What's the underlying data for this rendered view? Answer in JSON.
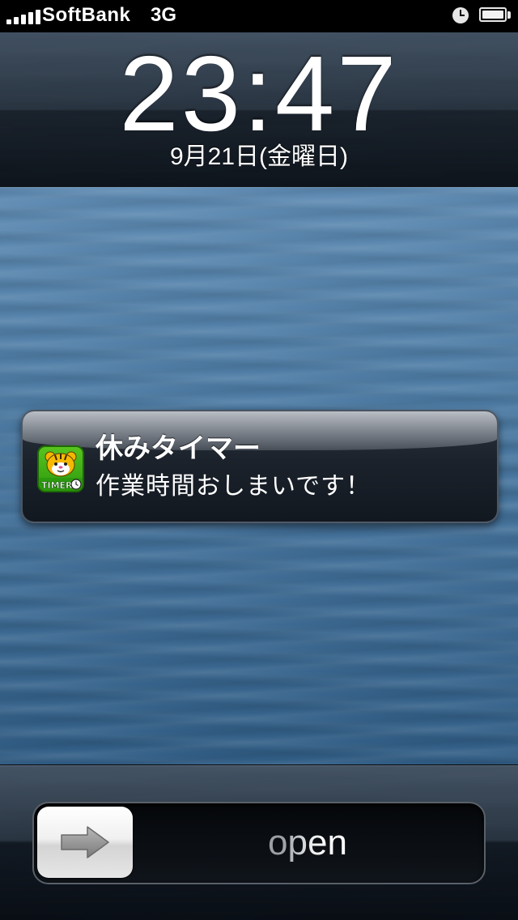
{
  "status_bar": {
    "carrier": "SoftBank",
    "network": "3G",
    "signal_bars": 5,
    "icons": [
      "signal-icon",
      "alarm-clock-icon",
      "battery-icon"
    ]
  },
  "lock_screen": {
    "time": "23:47",
    "date": "9月21日(金曜日)"
  },
  "notification": {
    "app_name": "休みタイマー",
    "message": "作業時間おしまいです！",
    "app_icon": "tiger-timer-app-icon"
  },
  "unlock_slider": {
    "label": "open",
    "knob_icon": "arrow-right-icon"
  },
  "colors": {
    "status_bar_bg": "#000000",
    "wallpaper_top": "#6b95bb",
    "wallpaper_bottom": "#244d73",
    "app_icon_green": "#3bab14",
    "slider_label": "#8a8e94"
  }
}
